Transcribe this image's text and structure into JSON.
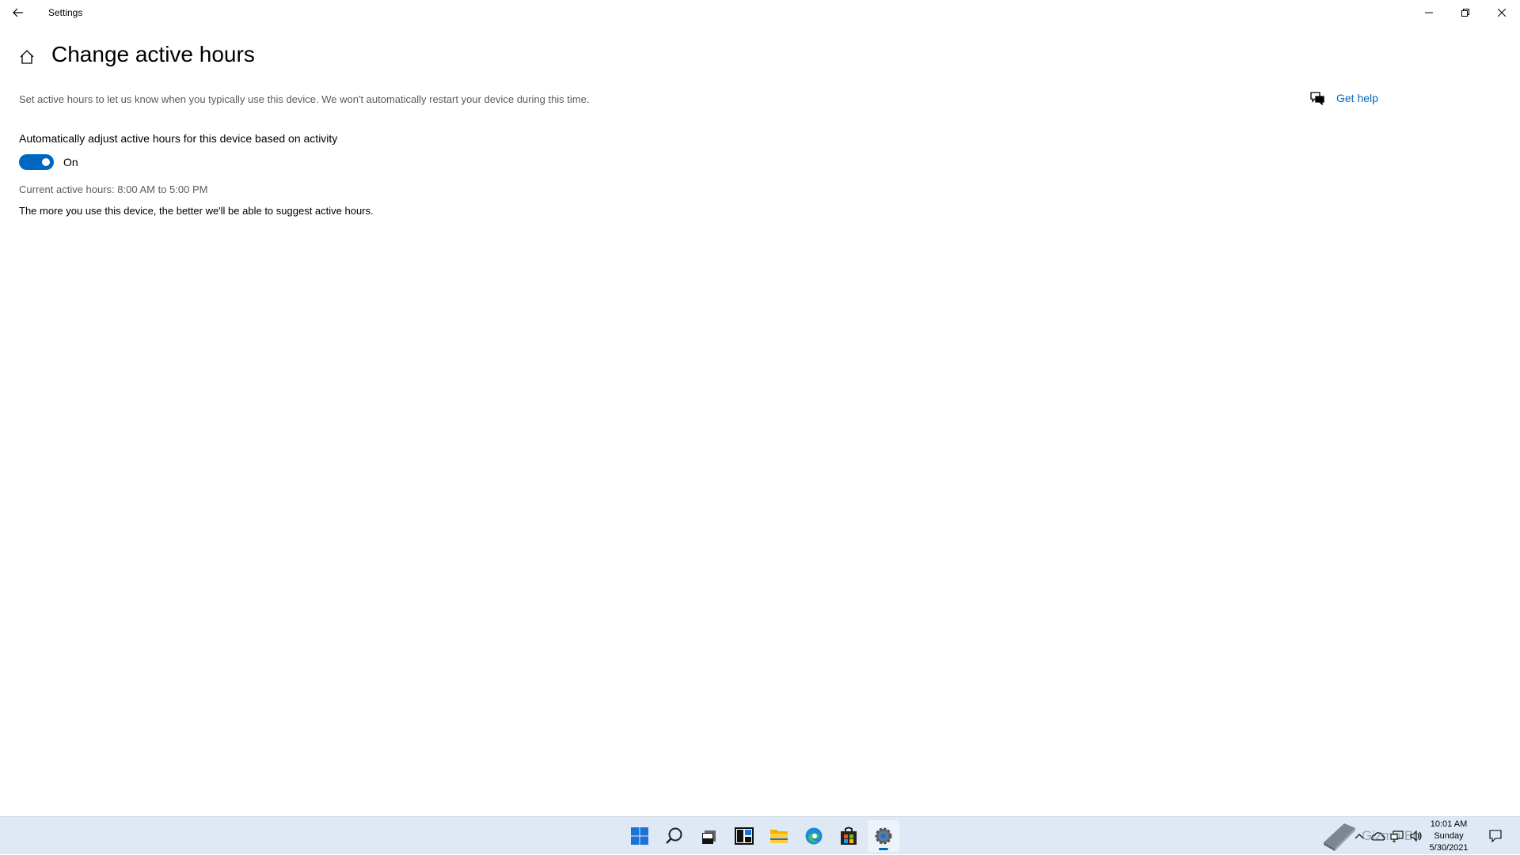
{
  "window": {
    "title": "Settings"
  },
  "page": {
    "title": "Change active hours",
    "description": "Set active hours to let us know when you typically use this device. We won't automatically restart your device during this time.",
    "get_help": "Get help"
  },
  "setting": {
    "label": "Automatically adjust active hours for this device based on activity",
    "toggle_state": "On",
    "toggle_on": true,
    "current_hours": "Current active hours: 8:00 AM to 5:00 PM",
    "suggestion": "The more you use this device, the better we'll be able to suggest active hours."
  },
  "taskbar": {
    "apps": [
      {
        "name": "start-icon"
      },
      {
        "name": "search-icon"
      },
      {
        "name": "task-view-icon"
      },
      {
        "name": "widgets-icon"
      },
      {
        "name": "file-explorer-icon"
      },
      {
        "name": "edge-icon"
      },
      {
        "name": "store-icon"
      },
      {
        "name": "settings-icon",
        "active": true
      }
    ],
    "watermark": "Gizmo Bo",
    "clock": {
      "time": "10:01 AM",
      "day": "Sunday",
      "date": "5/30/2021"
    }
  },
  "colors": {
    "accent": "#0067c0",
    "taskbar": "#dfe9f5",
    "secondary_text": "#5a5a5a"
  }
}
